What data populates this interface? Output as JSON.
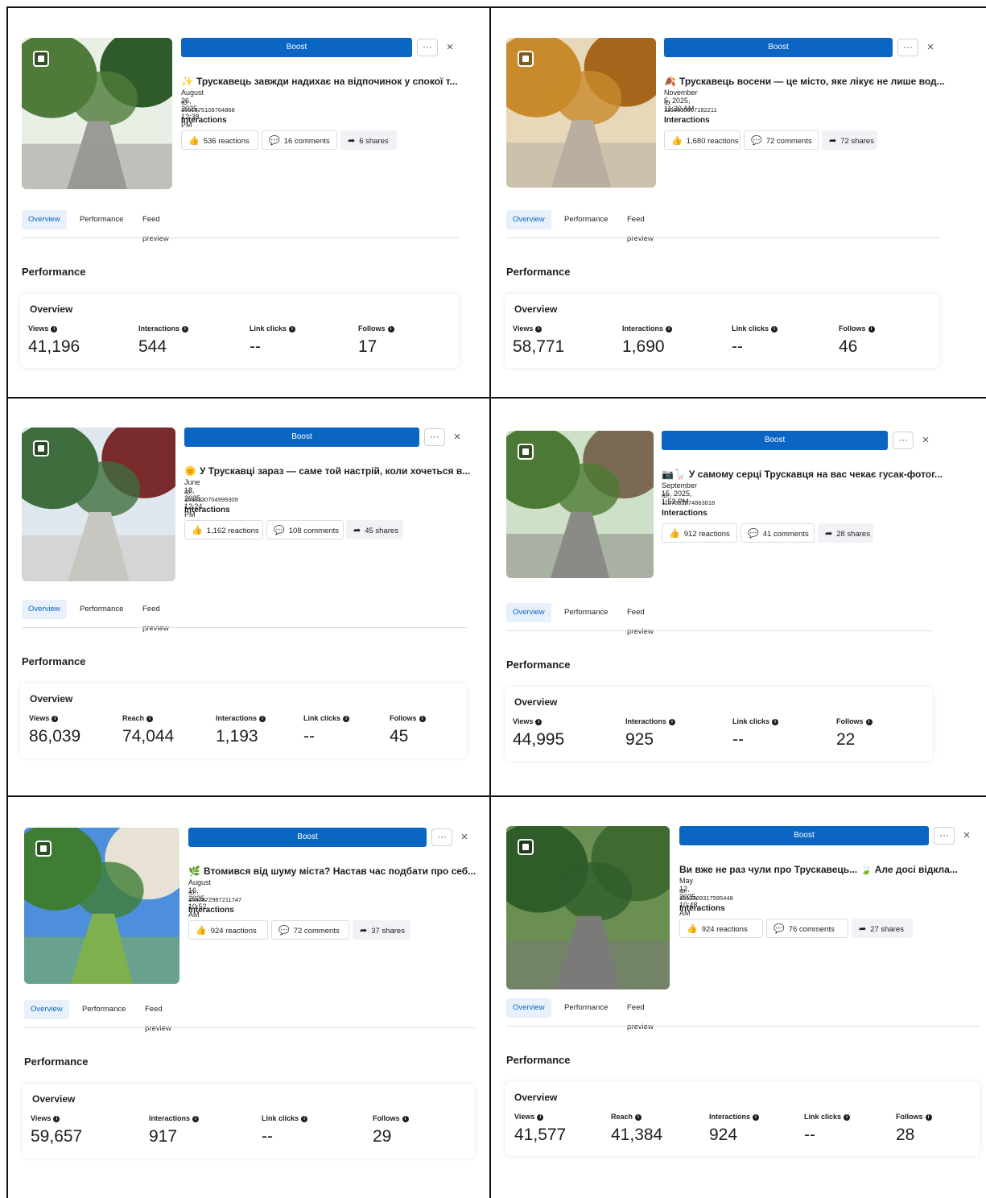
{
  "colors": {
    "boost": "#0a66c2",
    "active_tab_bg": "#e7f0fb",
    "active_tab_text": "#0a66c2"
  },
  "common": {
    "boost_label": "Boost",
    "more_label": "···",
    "close_label": "×",
    "interactions_label": "Interactions",
    "tabs": [
      "Overview",
      "Performance",
      "Feed preview"
    ],
    "performance_heading": "Performance",
    "overview_heading": "Overview",
    "metric_labels": {
      "views": "Views",
      "reach": "Reach",
      "interactions": "Interactions",
      "link_clicks": "Link clicks",
      "follows": "Follows"
    }
  },
  "posts": [
    {
      "emoji": "✨",
      "title": "Трускавець завжди надихає на відпочинок у спокої т...",
      "date": "August 26, 2025, 12:38 PM",
      "id": "ID: 1091675109764868",
      "reactions": "536 reactions",
      "comments": "16 comments",
      "shares": "6 shares",
      "metrics": {
        "views": "41,196",
        "interactions": "544",
        "link_clicks": "--",
        "follows": "17"
      }
    },
    {
      "emoji": "🍂",
      "title": "Трускавець восени — це місто, яке лікує не лише вод...",
      "date": "November 5, 2025, 11:20 AM",
      "id": "ID: 1150835007182211",
      "reactions": "1,680 reactions",
      "comments": "72 comments",
      "shares": "72 shares",
      "metrics": {
        "views": "58,771",
        "interactions": "1,690",
        "link_clicks": "--",
        "follows": "46"
      }
    },
    {
      "emoji": "🌞",
      "title": "У Трускавці зараз — саме той настрій, коли хочеться в...",
      "date": "June 18, 2025, 12:24 PM",
      "id": "ID: 1039330704999309",
      "reactions": "1,162 reactions",
      "comments": "108 comments",
      "shares": "45 shares",
      "metrics": {
        "views": "86,039",
        "reach": "74,044",
        "interactions": "1,193",
        "link_clicks": "--",
        "follows": "45"
      }
    },
    {
      "emoji": "📷🪿",
      "title": "У самому серці Трускавця на вас чекає гусак-фотог...",
      "date": "September 15, 2025, 1:53 PM",
      "id": "ID: 1107352274863818",
      "reactions": "912 reactions",
      "comments": "41 comments",
      "shares": "28 shares",
      "metrics": {
        "views": "44,995",
        "interactions": "925",
        "link_clicks": "--",
        "follows": "22"
      }
    },
    {
      "emoji": "🌿",
      "title": "Втомився від шуму міста? Настав час подбати про себ...",
      "date": "August 16, 2025, 10:52 AM",
      "id": "ID: 1083872987211747",
      "reactions": "924 reactions",
      "comments": "72 comments",
      "shares": "37 shares",
      "metrics": {
        "views": "59,657",
        "interactions": "917",
        "link_clicks": "--",
        "follows": "29"
      }
    },
    {
      "emoji": "",
      "title": "Ви вже не раз чули про Трускавець... 🍃 Але досі відкла...",
      "date": "May 12, 2025, 10:48 AM",
      "id": "ID: 1013369317595448",
      "reactions": "924 reactions",
      "comments": "76 comments",
      "shares": "27 shares",
      "metrics": {
        "views": "41,577",
        "reach": "41,384",
        "interactions": "924",
        "link_clicks": "--",
        "follows": "28"
      }
    }
  ]
}
